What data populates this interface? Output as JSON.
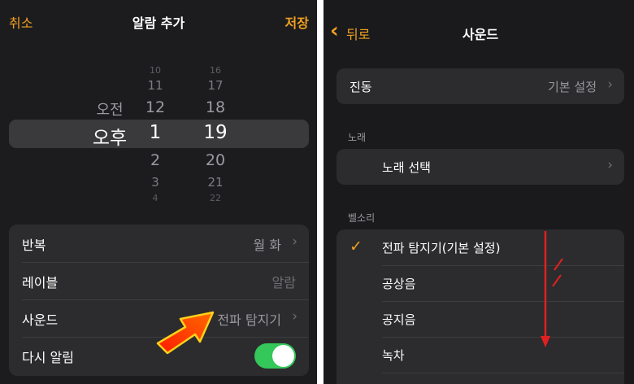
{
  "left_screen": {
    "nav": {
      "cancel": "취소",
      "title": "알람 추가",
      "save": "저장"
    },
    "picker": {
      "ampm": [
        "오전",
        "오후"
      ],
      "hours": [
        "10",
        "11",
        "12",
        "1",
        "2",
        "3",
        "4"
      ],
      "minutes": [
        "16",
        "17",
        "18",
        "19",
        "20",
        "21",
        "22"
      ],
      "selected": {
        "ampm": "오후",
        "hour": "1",
        "minute": "19"
      }
    },
    "settings": {
      "repeat": {
        "label": "반복",
        "value": "월 화"
      },
      "label": {
        "label": "레이블",
        "value": "알람"
      },
      "sound": {
        "label": "사운드",
        "value": "전파 탐지기"
      },
      "snooze": {
        "label": "다시 알림",
        "on": true
      }
    },
    "annotation_arrow_color": "#ff2a00"
  },
  "right_screen": {
    "nav": {
      "back": "뒤로",
      "title": "사운드"
    },
    "vibration": {
      "label": "진동",
      "value": "기본 설정"
    },
    "songs_header": "노래",
    "choose_song": "노래 선택",
    "ringtones_header": "벨소리",
    "ringtones": [
      {
        "name": "전파 탐지기(기본 설정)",
        "selected": true
      },
      {
        "name": "공상음",
        "selected": false
      },
      {
        "name": "공지음",
        "selected": false
      },
      {
        "name": "녹차",
        "selected": false
      }
    ],
    "accent_color": "#f0a020",
    "annotation_color": "#e02020"
  }
}
